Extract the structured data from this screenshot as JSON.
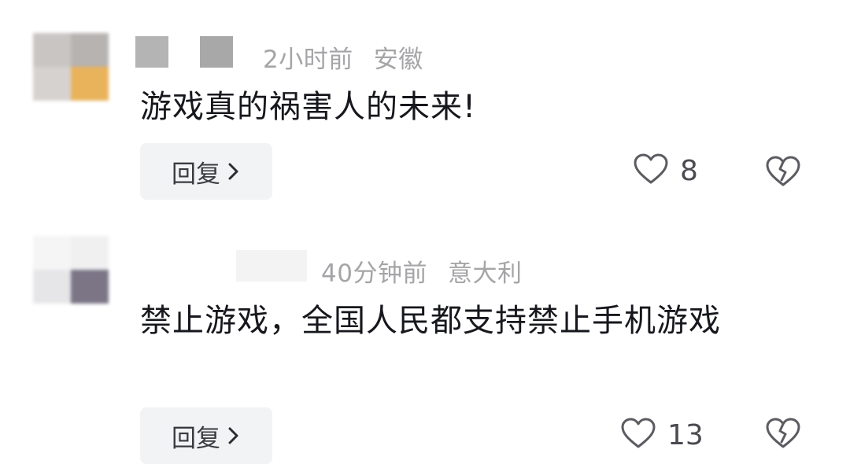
{
  "comments": [
    {
      "time": "2小时前",
      "location": "安徽",
      "text": "游戏真的祸害人的未来!",
      "reply_label": "回复",
      "like_count": "8",
      "avatar_colors": [
        "#c9c5c2",
        "#b7b3b0",
        "#d6d2cf",
        "#e9b35c"
      ]
    },
    {
      "time": "40分钟前",
      "location": "意大利",
      "text": "禁止游戏，全国人民都支持禁止手机游戏",
      "reply_label": "回复",
      "like_count": "13",
      "avatar_colors": [
        "#f5f5f6",
        "#f0f0f1",
        "#e6e6e8",
        "#7b7586"
      ]
    }
  ],
  "icons": {
    "like": "heart-outline-icon",
    "dislike": "broken-heart-icon",
    "reply_arrow": "chevron-right-icon"
  }
}
